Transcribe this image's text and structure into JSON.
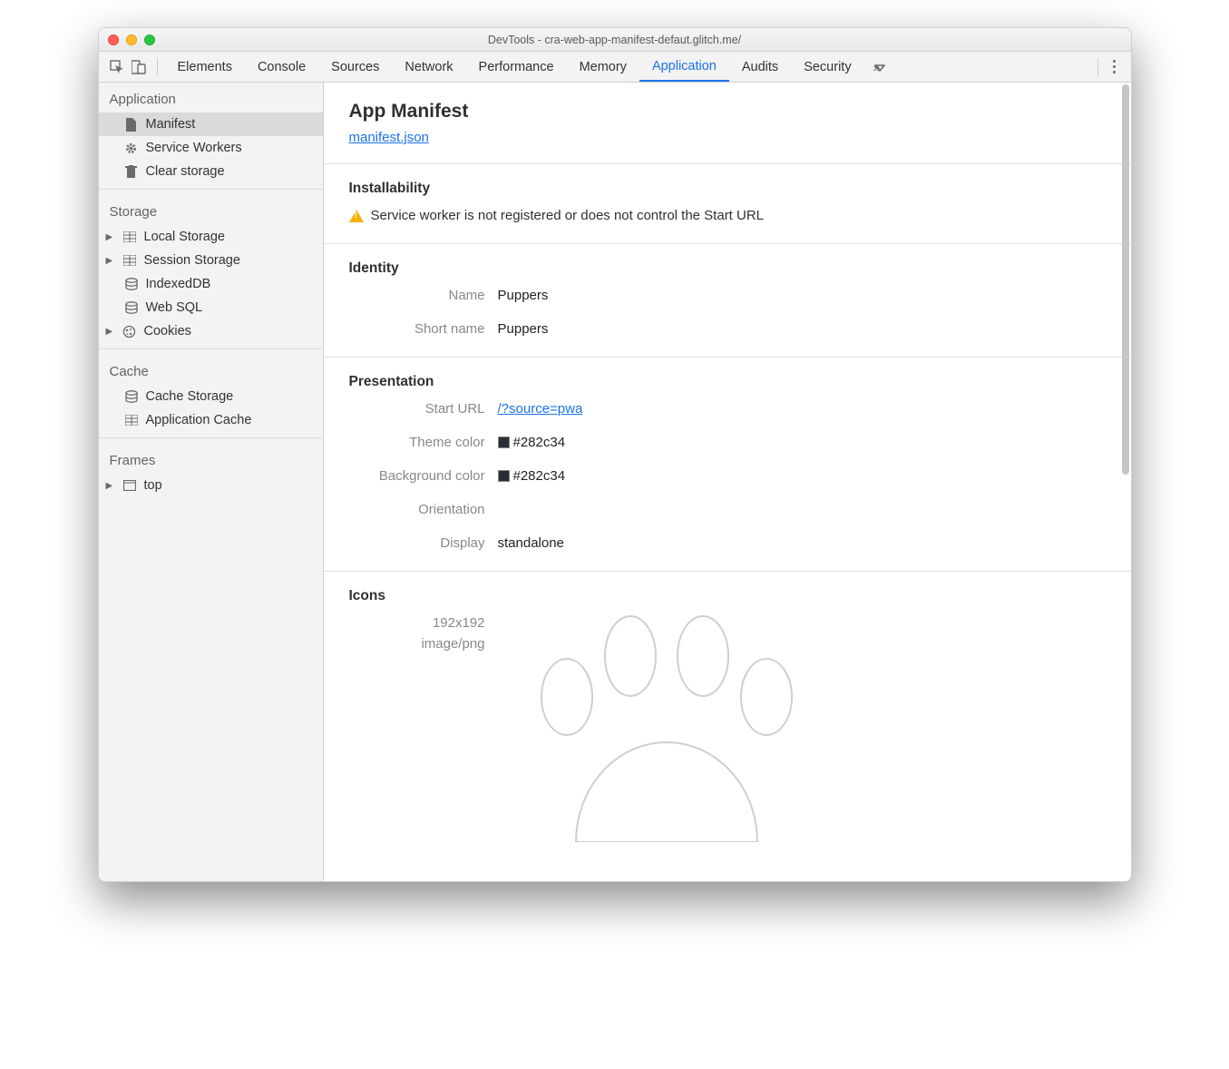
{
  "window": {
    "title": "DevTools - cra-web-app-manifest-defaut.glitch.me/"
  },
  "toolbar": {
    "tabs": [
      "Elements",
      "Console",
      "Sources",
      "Network",
      "Performance",
      "Memory",
      "Application",
      "Audits",
      "Security"
    ],
    "active_tab_index": 6
  },
  "sidebar": {
    "groups": [
      {
        "heading": "Application",
        "items": [
          {
            "icon": "file-icon",
            "label": "Manifest",
            "selected": true
          },
          {
            "icon": "gear-icon",
            "label": "Service Workers"
          },
          {
            "icon": "trash-icon",
            "label": "Clear storage"
          }
        ]
      },
      {
        "heading": "Storage",
        "items": [
          {
            "icon": "grid-icon",
            "label": "Local Storage",
            "expandable": true
          },
          {
            "icon": "grid-icon",
            "label": "Session Storage",
            "expandable": true
          },
          {
            "icon": "database-icon",
            "label": "IndexedDB"
          },
          {
            "icon": "database-icon",
            "label": "Web SQL"
          },
          {
            "icon": "cookie-icon",
            "label": "Cookies",
            "expandable": true
          }
        ]
      },
      {
        "heading": "Cache",
        "items": [
          {
            "icon": "database-icon",
            "label": "Cache Storage"
          },
          {
            "icon": "grid-icon",
            "label": "Application Cache"
          }
        ]
      },
      {
        "heading": "Frames",
        "items": [
          {
            "icon": "frame-icon",
            "label": "top",
            "expandable": true
          }
        ]
      }
    ]
  },
  "main": {
    "title": "App Manifest",
    "manifest_link": "manifest.json",
    "installability": {
      "heading": "Installability",
      "warning": "Service worker is not registered or does not control the Start URL"
    },
    "identity": {
      "heading": "Identity",
      "name_label": "Name",
      "name_value": "Puppers",
      "short_name_label": "Short name",
      "short_name_value": "Puppers"
    },
    "presentation": {
      "heading": "Presentation",
      "start_url_label": "Start URL",
      "start_url_value": "/?source=pwa",
      "theme_color_label": "Theme color",
      "theme_color_value": "#282c34",
      "background_color_label": "Background color",
      "background_color_value": "#282c34",
      "orientation_label": "Orientation",
      "orientation_value": "",
      "display_label": "Display",
      "display_value": "standalone"
    },
    "icons": {
      "heading": "Icons",
      "size": "192x192",
      "mime": "image/png"
    }
  }
}
